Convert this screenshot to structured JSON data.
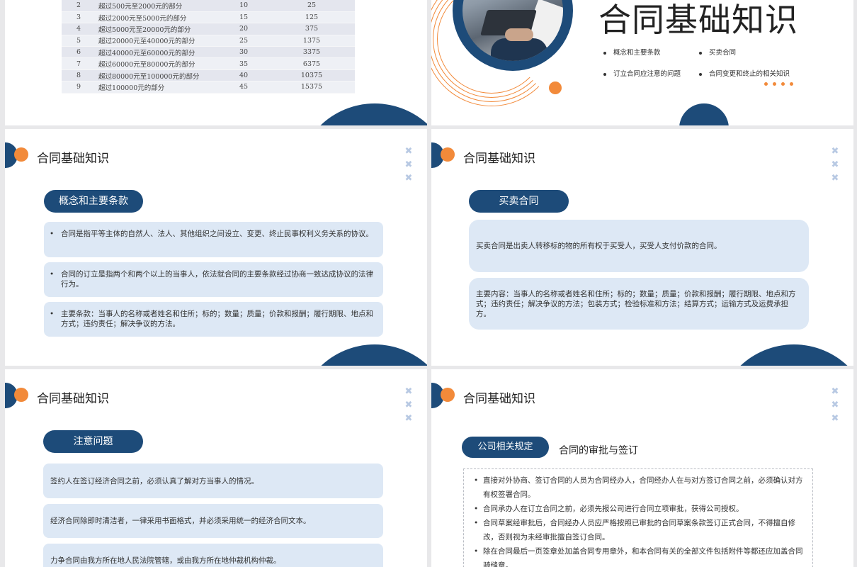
{
  "tax_table": {
    "rows": [
      [
        "2",
        "超过500元至2000元的部分",
        "10",
        "25"
      ],
      [
        "3",
        "超过2000元至5000元的部分",
        "15",
        "125"
      ],
      [
        "4",
        "超过5000元至20000元的部分",
        "20",
        "375"
      ],
      [
        "5",
        "超过20000元至40000元的部分",
        "25",
        "1375"
      ],
      [
        "6",
        "超过40000元至60000元的部分",
        "30",
        "3375"
      ],
      [
        "7",
        "超过60000元至80000元的部分",
        "35",
        "6375"
      ],
      [
        "8",
        "超过80000元至100000元的部分",
        "40",
        "10375"
      ],
      [
        "9",
        "超过100000元的部分",
        "45",
        "15375"
      ]
    ]
  },
  "cover": {
    "title": "合同基础知识",
    "bullets": [
      "概念和主要条款",
      "买卖合同",
      "订立合同应注意的问题",
      "合同变更和终止的相关知识"
    ]
  },
  "slide_concept": {
    "header": "合同基础知识",
    "pill": "概念和主要条款",
    "cards": [
      "合同是指平等主体的自然人、法人、其他组织之间设立、变更、终止民事权利义务关系的协议。",
      "合同的订立是指两个和两个以上的当事人，依法就合同的主要条款经过协商一致达成协议的法律行为。",
      "主要条款：当事人的名称或者姓名和住所；标的；数量；质量；价款和报酬；履行期限、地点和方式；违约责任；解决争议的方法。"
    ]
  },
  "slide_sale": {
    "header": "合同基础知识",
    "pill": "买卖合同",
    "cards": [
      "买卖合同是出卖人转移标的物的所有权于买受人，买受人支付价款的合同。",
      "主要内容：当事人的名称或者姓名和住所；标的；数量；质量；价款和报酬；履行期限、地点和方式；违约责任；解决争议的方法；包装方式；检验标准和方法；结算方式；运输方式及运费承担方。"
    ]
  },
  "slide_notes": {
    "header": "合同基础知识",
    "pill": "注意问题",
    "cards": [
      "签约人在签订经济合同之前，必须认真了解对方当事人的情况。",
      "经济合同除即时清洁者，一律采用书面格式，并必须采用统一的经济合同文本。",
      "力争合同由我方所在地人民法院管辖，或由我方所在地仲裁机构仲裁。"
    ]
  },
  "slide_company": {
    "header": "合同基础知识",
    "pill": "公司相关规定",
    "subtitle": "合同的审批与签订",
    "items": [
      "直接对外协商、签订合同的人员为合同经办人，合同经办人在与对方签订合同之前，必须确认对方有权签署合同。",
      "合同承办人在订立合同之前，必须先报公司进行合同立项审批，获得公司授权。",
      "合同草案经审批后，合同经办人员应严格按照已审批的合同草案条款签订正式合同，不得擅自修改，否则视为未经审批擅自签订合同。",
      "除在合同最后一页签章处加盖合同专用章外，和本合同有关的全部文件包括附件等都还应加盖合同骑缝章。"
    ]
  },
  "colors": {
    "navy": "#1d4b79",
    "orange": "#f28a3a",
    "card": "#dde8f5"
  }
}
